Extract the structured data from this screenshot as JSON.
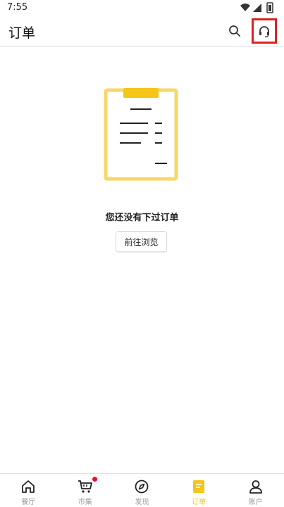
{
  "status_bar": {
    "time": "7:55"
  },
  "header": {
    "title": "订单",
    "search_icon": "search-icon",
    "support_icon": "headset-icon"
  },
  "empty_state": {
    "message": "您还没有下过订单",
    "button_label": "前往浏览",
    "accent": "#f7d76a"
  },
  "tabbar": {
    "active_color": "#f5c518",
    "inactive_color": "#999999",
    "tabs": [
      {
        "label": "餐厅",
        "icon": "home-icon",
        "active": false,
        "badge": false
      },
      {
        "label": "市集",
        "icon": "cart-icon",
        "active": false,
        "badge": true
      },
      {
        "label": "发现",
        "icon": "compass-icon",
        "active": false,
        "badge": false
      },
      {
        "label": "订单",
        "icon": "order-icon",
        "active": true,
        "badge": false
      },
      {
        "label": "账户",
        "icon": "account-icon",
        "active": false,
        "badge": false
      }
    ]
  },
  "highlight_color": "#e02020"
}
